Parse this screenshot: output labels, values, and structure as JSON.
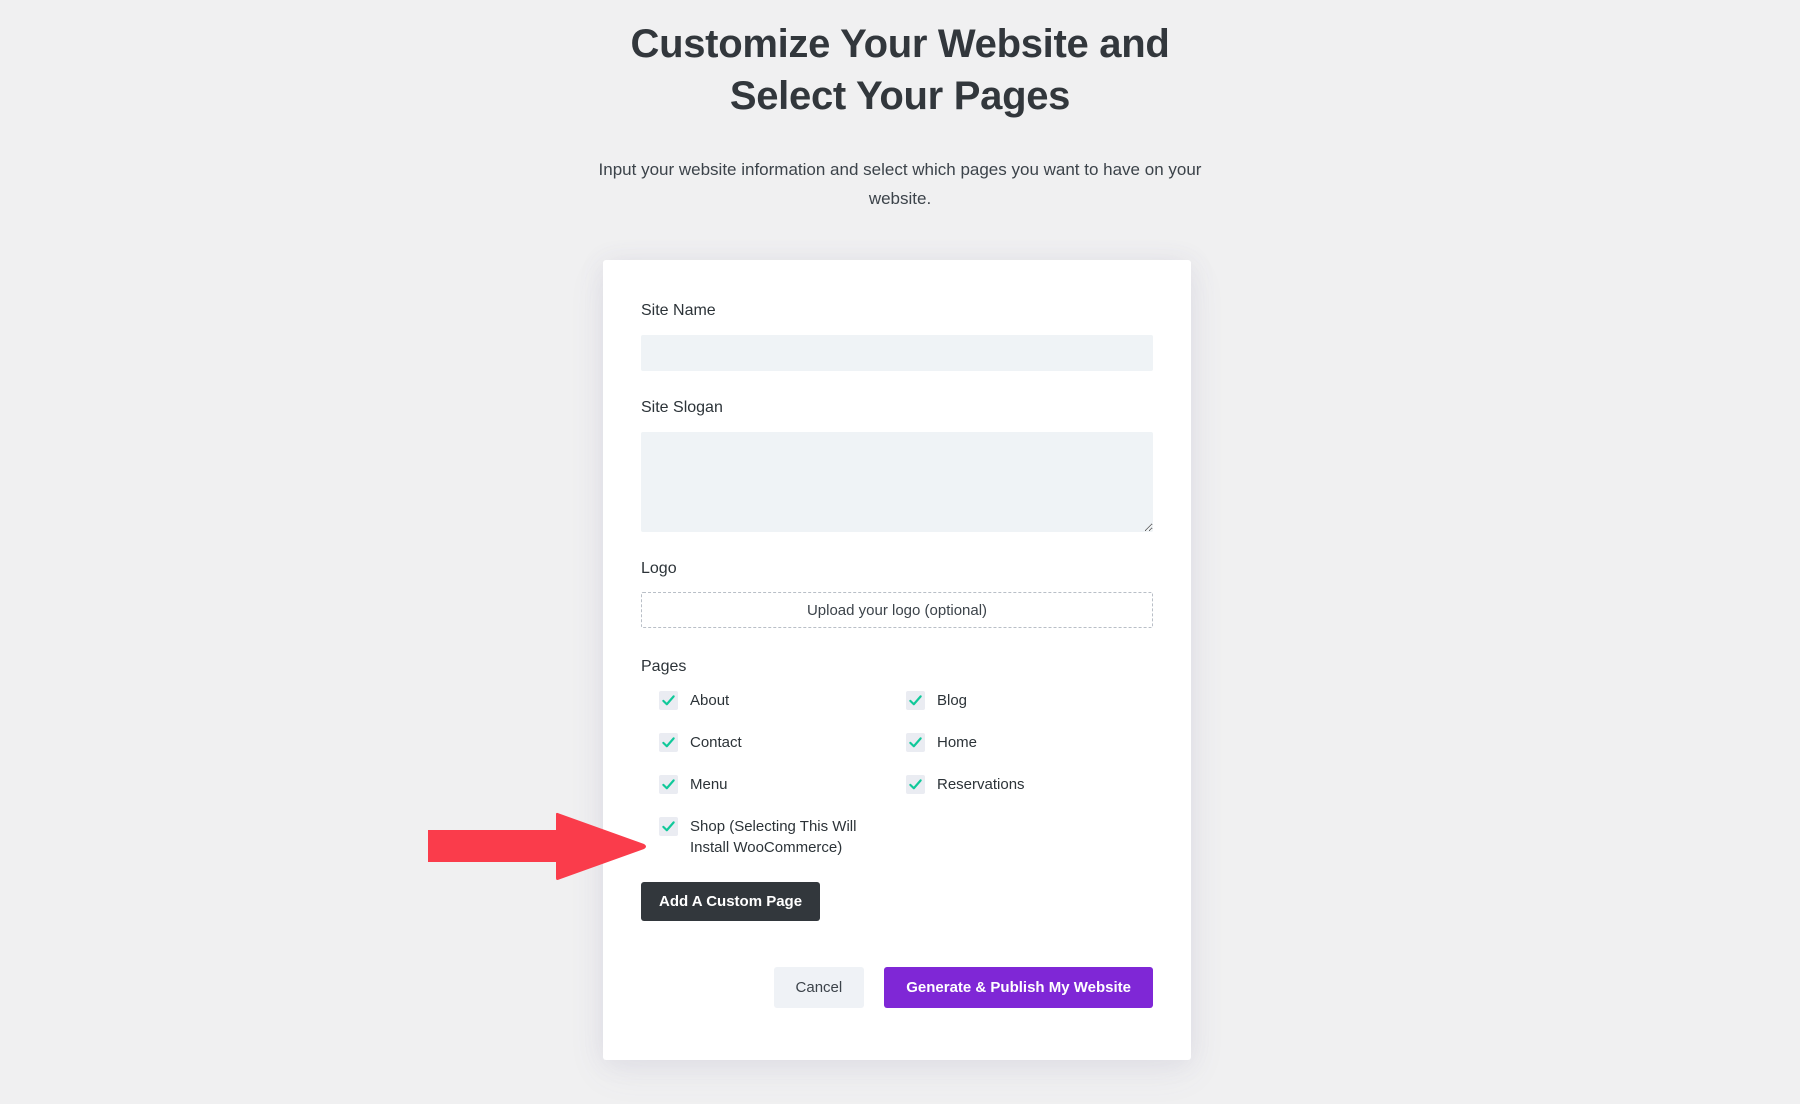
{
  "header": {
    "title": "Customize Your Website and Select Your Pages",
    "subtitle": "Input your website information and select which pages you want to have on your website."
  },
  "form": {
    "site_name": {
      "label": "Site Name",
      "value": "",
      "placeholder": ""
    },
    "site_slogan": {
      "label": "Site Slogan",
      "value": "",
      "placeholder": ""
    },
    "logo": {
      "label": "Logo",
      "upload_text": "Upload your logo (optional)"
    },
    "pages": {
      "label": "Pages",
      "items": [
        {
          "label": "About",
          "checked": true
        },
        {
          "label": "Blog",
          "checked": true
        },
        {
          "label": "Contact",
          "checked": true
        },
        {
          "label": "Home",
          "checked": true
        },
        {
          "label": "Menu",
          "checked": true
        },
        {
          "label": "Reservations",
          "checked": true
        },
        {
          "label": "Shop (Selecting This Will Install WooCommerce)",
          "checked": true
        }
      ]
    },
    "add_custom_page_label": "Add A Custom Page"
  },
  "actions": {
    "cancel_label": "Cancel",
    "primary_label": "Generate & Publish My Website"
  },
  "colors": {
    "page_background": "#f0f0f1",
    "card_background": "#ffffff",
    "input_background": "#eff3f6",
    "checkbox_background": "#eaecf2",
    "check_color": "#10c99a",
    "primary_button": "#7f27d6",
    "dark_button": "#32373c",
    "cancel_button": "#eff2f6",
    "annotation_arrow": "#fa3c4b",
    "text_primary": "#2c3338",
    "text_heading": "#32373c"
  },
  "annotation": {
    "arrow_direction": "right",
    "points_at": "Shop (Selecting This Will Install WooCommerce)"
  }
}
